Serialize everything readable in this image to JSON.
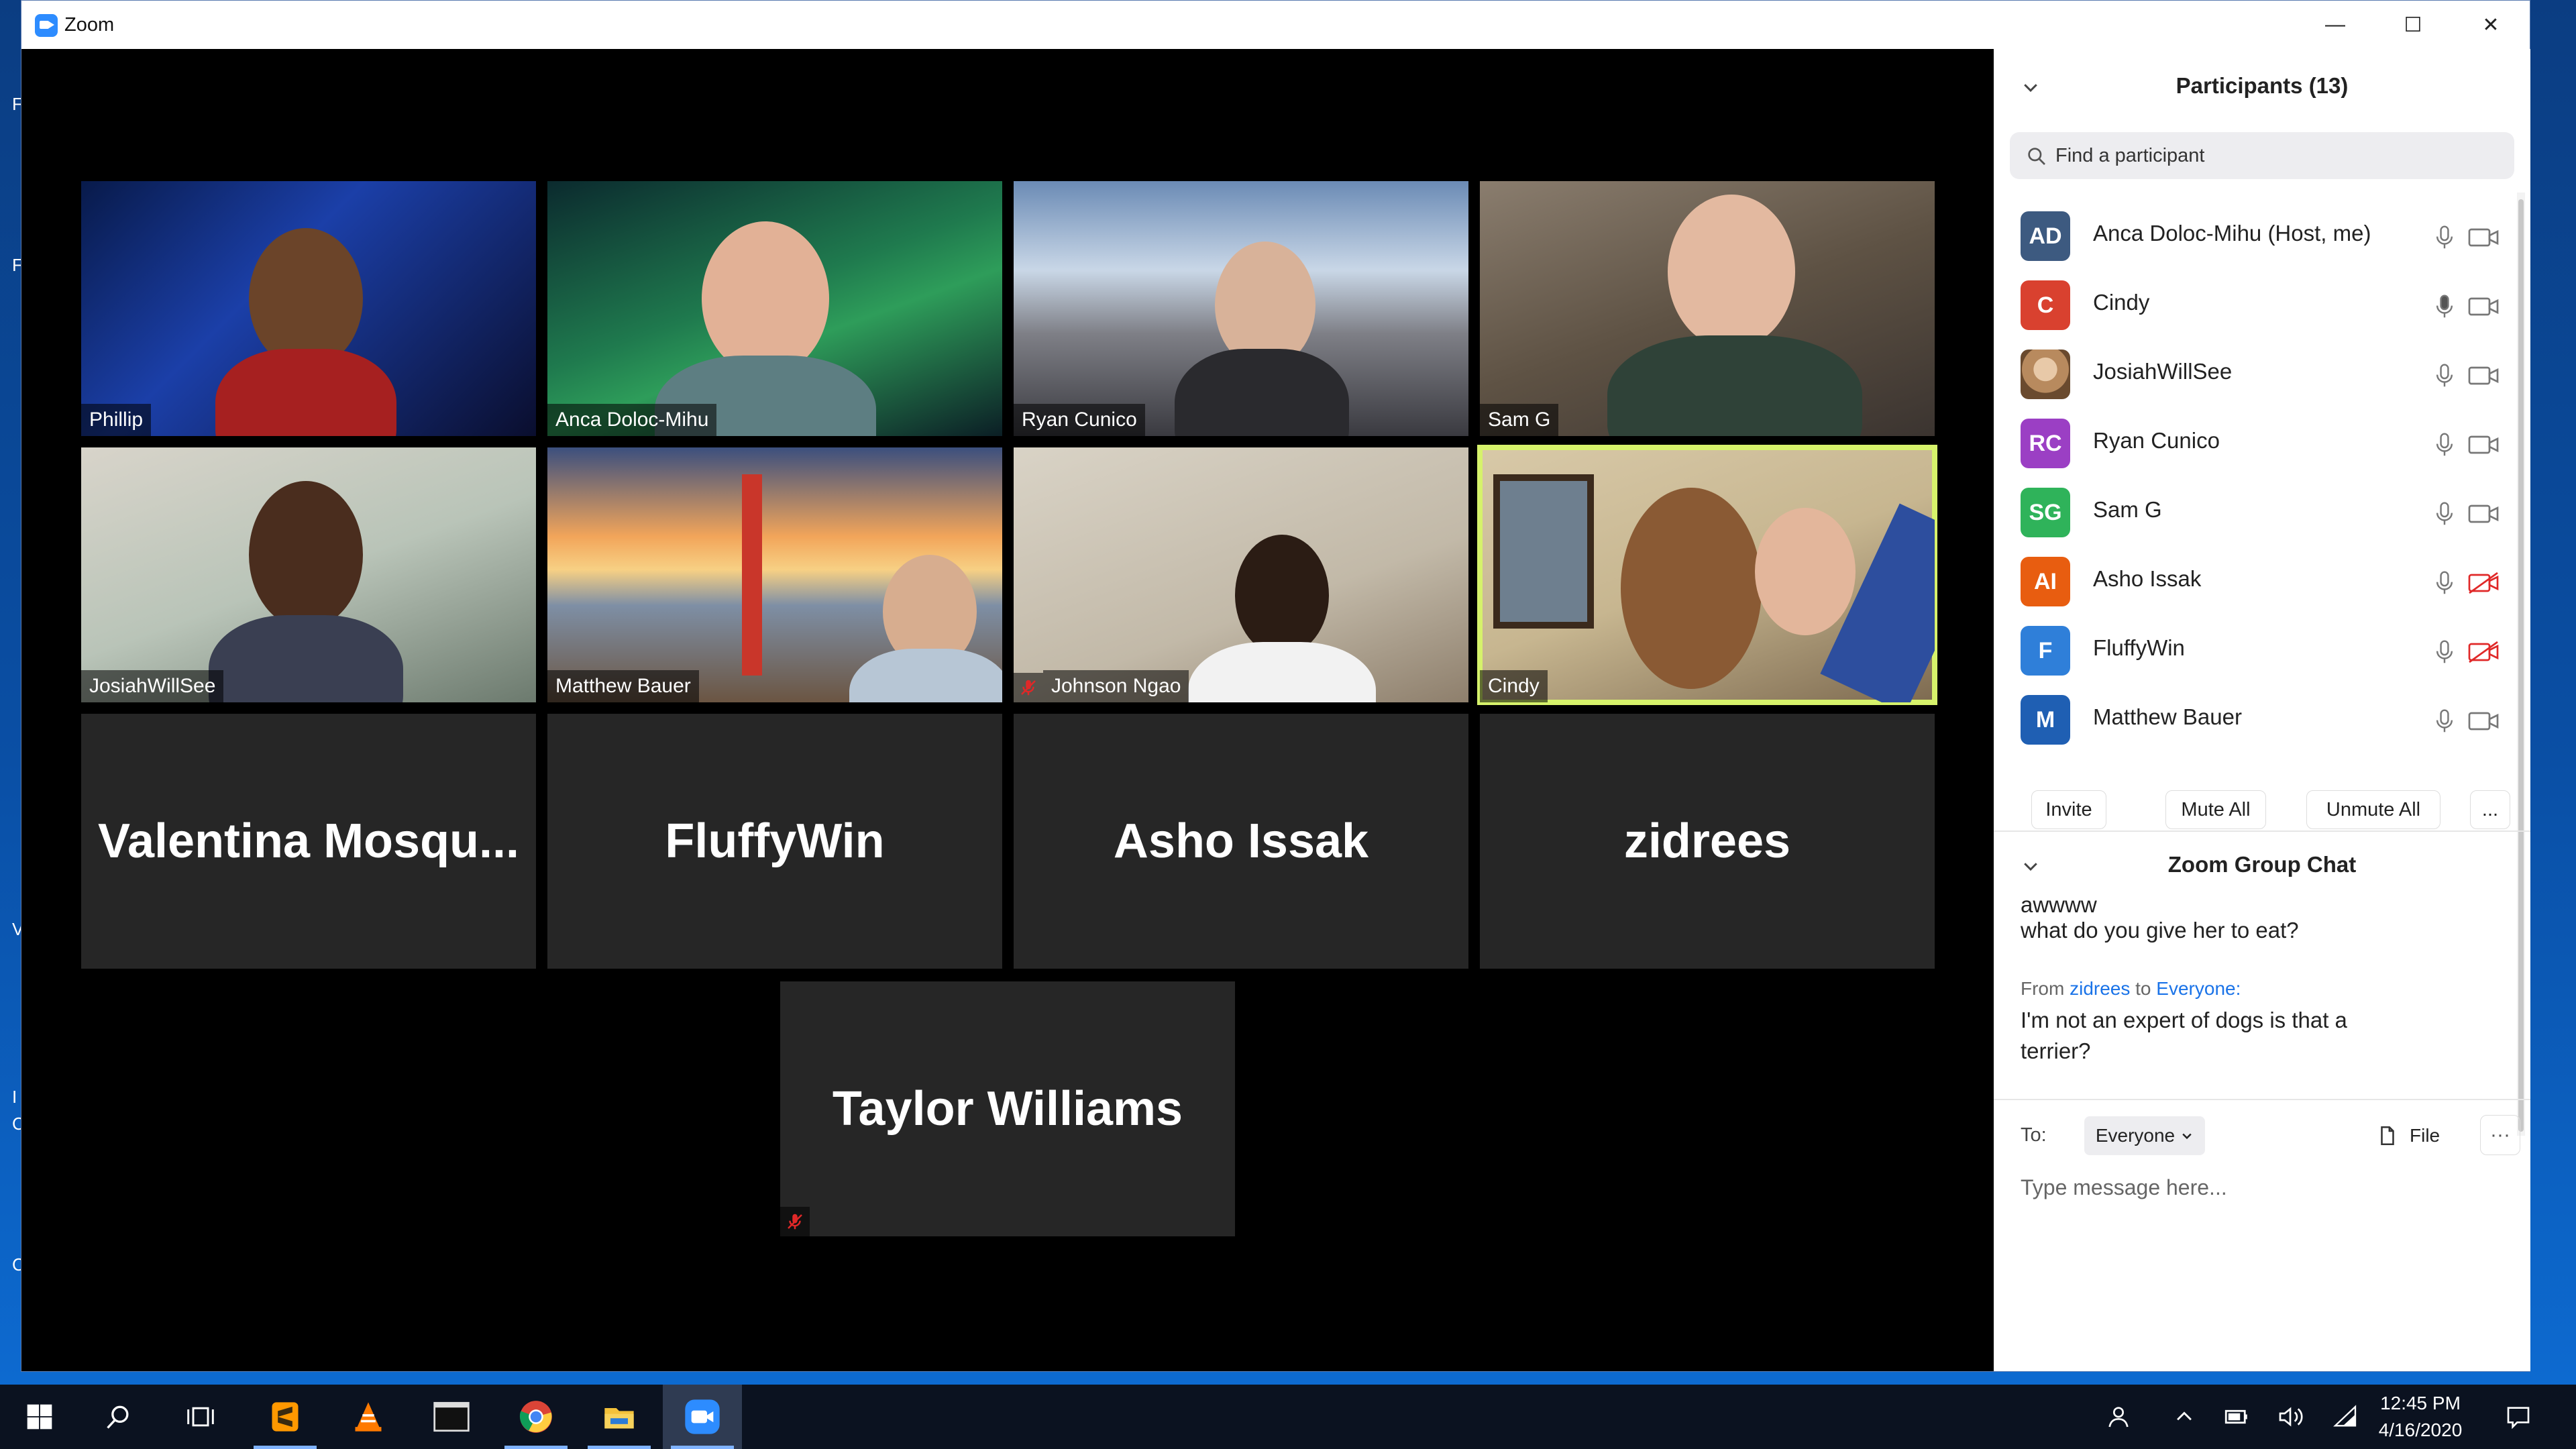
{
  "window": {
    "title": "Zoom",
    "minimize": "—",
    "maximize": "☐",
    "close": "✕"
  },
  "desktop_letters": [
    "F",
    "F",
    "V",
    "I",
    "C",
    "C"
  ],
  "video_tiles": [
    {
      "name": "Phillip",
      "type": "video",
      "muted": false
    },
    {
      "name": "Anca Doloc-Mihu",
      "type": "video",
      "muted": false
    },
    {
      "name": "Ryan Cunico",
      "type": "video",
      "muted": false
    },
    {
      "name": "Sam G",
      "type": "video",
      "muted": false
    },
    {
      "name": "JosiahWillSee",
      "type": "video",
      "muted": false
    },
    {
      "name": "Matthew Bauer",
      "type": "video",
      "muted": false
    },
    {
      "name": "Johnson Ngao",
      "type": "video",
      "muted": true
    },
    {
      "name": "Cindy",
      "type": "video",
      "muted": false,
      "speaking": true
    },
    {
      "name": "Valentina  Mosqu...",
      "type": "name",
      "muted": false
    },
    {
      "name": "FluffyWin",
      "type": "name",
      "muted": false
    },
    {
      "name": "Asho Issak",
      "type": "name",
      "muted": false
    },
    {
      "name": "zidrees",
      "type": "name",
      "muted": false
    },
    {
      "name": "Taylor Williams",
      "type": "name",
      "muted": true
    }
  ],
  "participants": {
    "title": "Participants (13)",
    "search_placeholder": "Find a participant",
    "list": [
      {
        "initials": "AD",
        "name": "Anca Doloc-Mihu (Host, me)",
        "color": "#3d5a80",
        "mic_active": false,
        "video_off": false
      },
      {
        "initials": "C",
        "name": "Cindy",
        "color": "#d9412f",
        "mic_active": true,
        "video_off": false
      },
      {
        "initials": "",
        "name": "JosiahWillSee",
        "color": "#b88a5e",
        "mic_active": false,
        "video_off": false
      },
      {
        "initials": "RC",
        "name": "Ryan Cunico",
        "color": "#9b3fc4",
        "mic_active": false,
        "video_off": false
      },
      {
        "initials": "SG",
        "name": "Sam G",
        "color": "#2fb35a",
        "mic_active": false,
        "video_off": false
      },
      {
        "initials": "AI",
        "name": "Asho Issak",
        "color": "#e85d10",
        "mic_active": false,
        "video_off": true
      },
      {
        "initials": "F",
        "name": "FluffyWin",
        "color": "#2f7fd9",
        "mic_active": false,
        "video_off": true
      },
      {
        "initials": "M",
        "name": "Matthew Bauer",
        "color": "#1f5fb3",
        "mic_active": false,
        "video_off": false
      }
    ],
    "actions": {
      "invite": "Invite",
      "mute_all": "Mute All",
      "unmute_all": "Unmute All",
      "more": "..."
    }
  },
  "chat": {
    "title": "Zoom Group Chat",
    "messages": [
      {
        "text": "awwww"
      },
      {
        "text": "what do you give her to eat?"
      },
      {
        "from_label": "From",
        "from": "zidrees",
        "to_label": "to",
        "to": "Everyone:"
      },
      {
        "text": "I'm not an expert of dogs is that a"
      },
      {
        "text": "terrier?"
      }
    ],
    "to_label": "To:",
    "to_value": "Everyone",
    "file_label": "File",
    "more": "···",
    "input_placeholder": "Type message here..."
  },
  "taskbar": {
    "time": "12:45 PM",
    "date": "4/16/2020"
  },
  "colors": {
    "accent": "#2D8CFF",
    "speaking_border": "#d6f26b",
    "muted_red": "#e02828"
  }
}
